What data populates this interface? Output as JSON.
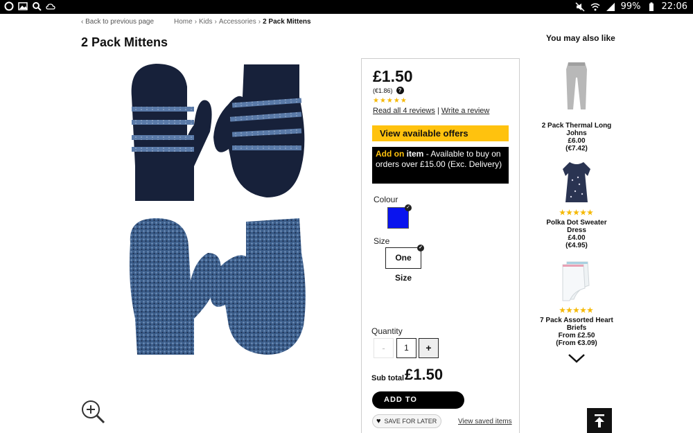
{
  "status_bar": {
    "battery": "99%",
    "time": "22:06"
  },
  "nav": {
    "back_link": "Back to previous page",
    "breadcrumb": [
      "Home",
      "Kids",
      "Accessories",
      "2 Pack Mittens"
    ],
    "breadcrumb_separator": "›"
  },
  "product": {
    "title": "2 Pack Mittens",
    "price": "£1.50",
    "price_euro": "(€1.86)",
    "rating_stars": "★★★★★",
    "rating": 5,
    "reviews_link": "Read all 4 reviews",
    "reviews_separator": "|",
    "write_review_link": "Write a review",
    "offers_button": "View available offers",
    "addon": {
      "highlight": "Add on",
      "bold": "item",
      "text": "- Available to buy on orders over £15.00 (Exc. Delivery)"
    },
    "colour_label": "Colour",
    "colour_selected": "#0a14ee",
    "size_label": "Size",
    "size_selected": "One Size",
    "quantity_label": "Quantity",
    "quantity_minus": "-",
    "quantity_value": "1",
    "quantity_plus": "+",
    "subtotal_label": "Sub total",
    "subtotal_value": "£1.50",
    "add_to_basket": "ADD TO BASKET",
    "add_to_basket_arrow": "→",
    "save_for_later": "SAVE FOR LATER",
    "view_saved": "View saved items"
  },
  "recommendations": {
    "title": "You may also like",
    "items": [
      {
        "name": "2 Pack Thermal Long Johns",
        "price": "£6.00",
        "price_euro": "(€7.42)",
        "stars": "",
        "image_icon": "long-johns-icon"
      },
      {
        "name": "Polka Dot Sweater Dress",
        "price": "£4.00",
        "price_euro": "(€4.95)",
        "stars": "★★★★★",
        "image_icon": "dress-icon"
      },
      {
        "name": "7 Pack Assorted Heart Briefs",
        "price": "From £2.50",
        "price_euro": "(From €3.09)",
        "stars": "★★★★★",
        "image_icon": "briefs-icon"
      }
    ]
  },
  "colors": {
    "accent_yellow": "#ffc20e",
    "star_color": "#f5b800",
    "mitten_navy": "#17213a",
    "mitten_stripe": "#5a7aa8",
    "mitten_marl": "#3b5d8a"
  }
}
